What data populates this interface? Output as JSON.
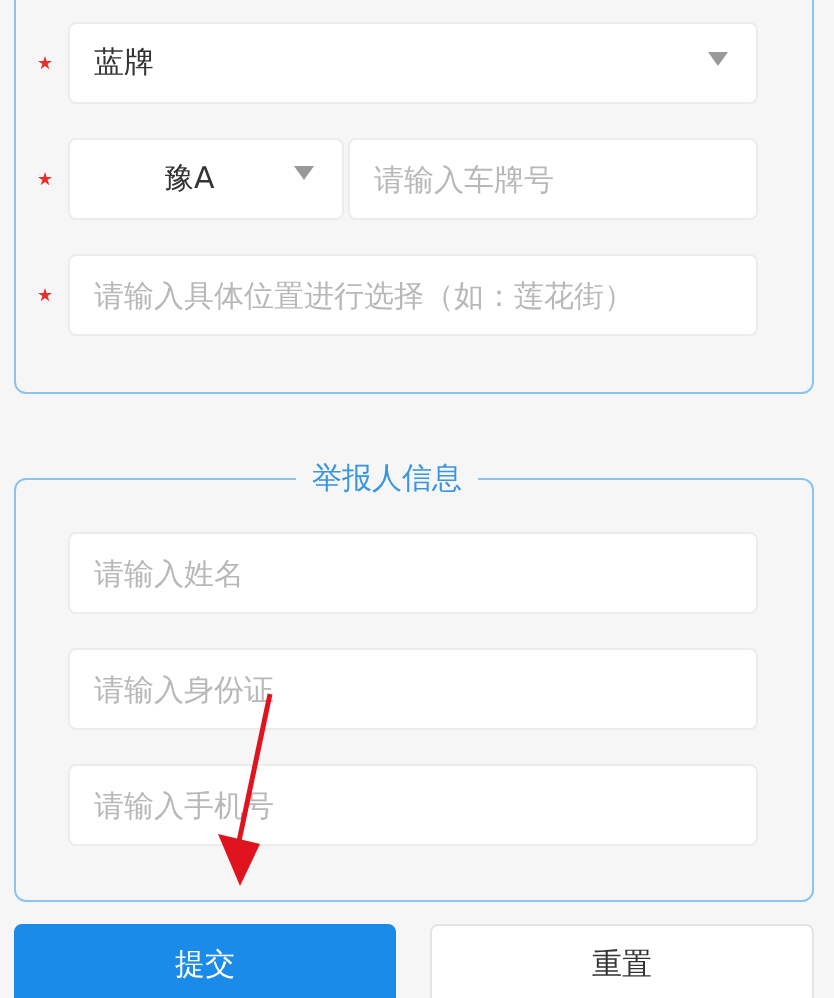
{
  "vehicle_section": {
    "fields": [
      {
        "kind": "select",
        "value": "蓝牌",
        "required": true
      },
      {
        "kind": "plate",
        "province": "豫A",
        "placeholder": "请输入车牌号",
        "required": true
      },
      {
        "kind": "text",
        "placeholder": "请输入具体位置进行选择（如：莲花街）",
        "required": true
      }
    ]
  },
  "reporter_section": {
    "title": "举报人信息",
    "fields": [
      {
        "kind": "text",
        "placeholder": "请输入姓名",
        "required": false
      },
      {
        "kind": "text",
        "placeholder": "请输入身份证",
        "required": false
      },
      {
        "kind": "text",
        "placeholder": "请输入手机号",
        "required": false
      }
    ]
  },
  "buttons": [
    {
      "label": "提交",
      "kind": "primary"
    },
    {
      "label": "重置",
      "kind": "default"
    }
  ]
}
